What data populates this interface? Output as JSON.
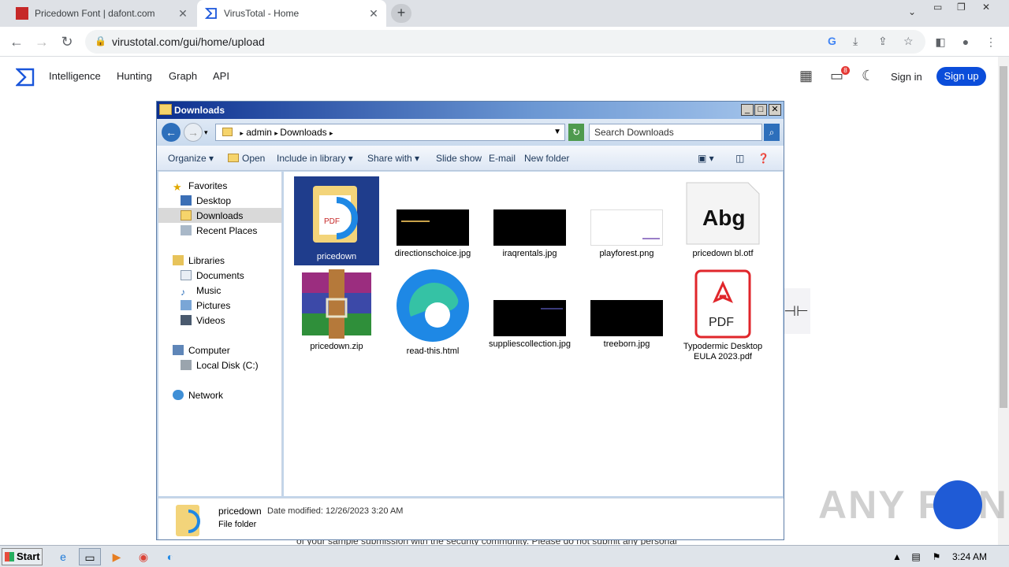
{
  "browser": {
    "tabs": [
      {
        "title": "Pricedown Font | dafont.com",
        "favicon": "dafont-icon"
      },
      {
        "title": "VirusTotal - Home",
        "favicon": "virustotal-icon"
      }
    ],
    "new_tab": "+",
    "url": "virustotal.com/gui/home/upload"
  },
  "vt": {
    "nav": [
      "Intelligence",
      "Hunting",
      "Graph",
      "API"
    ],
    "notification_count": "8",
    "sign_in": "Sign in",
    "sign_up": "Sign up",
    "bottom_text": "of your sample submission with the security community. Please do not submit any personal"
  },
  "explorer": {
    "title": "Downloads",
    "breadcrumb": [
      "admin",
      "Downloads"
    ],
    "search_placeholder": "Search Downloads",
    "commands": [
      "Organize",
      "Open",
      "Include in library",
      "Share with",
      "Slide show",
      "E-mail",
      "New folder"
    ],
    "nav": {
      "favorites": "Favorites",
      "desktop": "Desktop",
      "downloads": "Downloads",
      "recent": "Recent Places",
      "libraries": "Libraries",
      "documents": "Documents",
      "music": "Music",
      "pictures": "Pictures",
      "videos": "Videos",
      "computer": "Computer",
      "local_disk": "Local Disk (C:)",
      "network": "Network"
    },
    "items": [
      {
        "name": "pricedown"
      },
      {
        "name": "directionschoice.jpg"
      },
      {
        "name": "iraqrentals.jpg"
      },
      {
        "name": "playforest.png"
      },
      {
        "name": "pricedown bl.otf"
      },
      {
        "name": "pricedown.zip"
      },
      {
        "name": "read-this.html"
      },
      {
        "name": "suppliescollection.jpg"
      },
      {
        "name": "treeborn.jpg"
      },
      {
        "name": "Typodermic Desktop EULA 2023.pdf"
      }
    ],
    "details": {
      "name": "pricedown",
      "date_modified": "Date modified: 12/26/2023 3:20 AM",
      "type": "File folder"
    }
  },
  "taskbar": {
    "start": "Start",
    "clock": "3:24 AM"
  },
  "watermark": "ANY RUN",
  "colors": {
    "accent": "#0b4dda",
    "selection": "#1f3d8c"
  }
}
